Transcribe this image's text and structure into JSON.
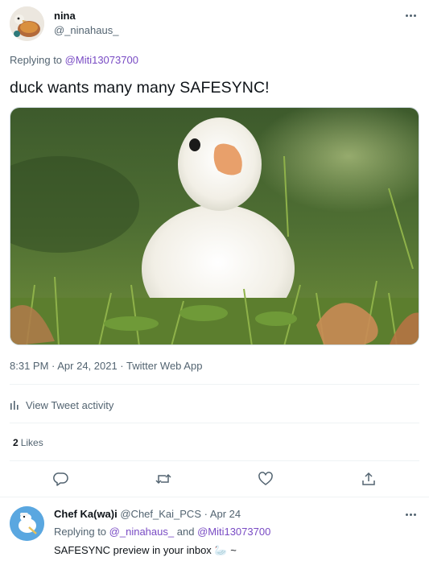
{
  "tweet": {
    "author": {
      "name": "nina",
      "handle": "@_ninahaus_"
    },
    "replying_label": "Replying to",
    "replying_to": "@Miti13073700",
    "text": "duck wants many many SAFESYNC!",
    "media": {
      "description_icon": "duckling-photo"
    },
    "timestamp": "8:31 PM · Apr 24, 2021 · Twitter Web App",
    "activity_label": "View Tweet activity",
    "likes": {
      "count": "2",
      "label": "Likes"
    },
    "actions": [
      "reply-icon",
      "retweet-icon",
      "like-icon",
      "share-icon"
    ]
  },
  "reply": {
    "name": "Chef Ka(wa)i",
    "handle": "@Chef_Kai_PCS",
    "separator": " · ",
    "date": "Apr 24",
    "replying_label": "Replying to",
    "mention_1": "@_ninahaus_",
    "and_label": "and",
    "mention_2": "@Miti13073700",
    "text": "SAFESYNC preview in your inbox 🦢 ~"
  },
  "colors": {
    "mention": "#794bc4",
    "secondary_text": "#536471",
    "primary_text": "#0f1419",
    "divider": "#eff3f4"
  }
}
